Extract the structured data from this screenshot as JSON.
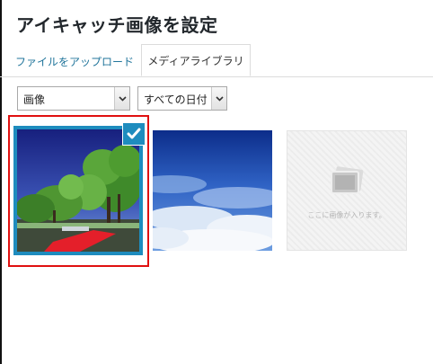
{
  "dialog": {
    "title": "アイキャッチ画像を設定"
  },
  "tabs": {
    "upload_label": "ファイルをアップロード",
    "library_label": "メディアライブラリ",
    "active": "library"
  },
  "filters": {
    "type_value": "画像",
    "date_value": "すべての日付"
  },
  "library": {
    "items": [
      {
        "kind": "photo",
        "subject": "trees-and-red-carpet",
        "selected": true
      },
      {
        "kind": "photo",
        "subject": "sky-above-clouds",
        "selected": false
      },
      {
        "kind": "placeholder",
        "text": "ここに画像が入ります。",
        "icon": "image-stack-icon",
        "selected": false
      }
    ]
  },
  "colors": {
    "accent": "#1e8cbe",
    "link": "#21759b",
    "highlight": "#e01010"
  }
}
